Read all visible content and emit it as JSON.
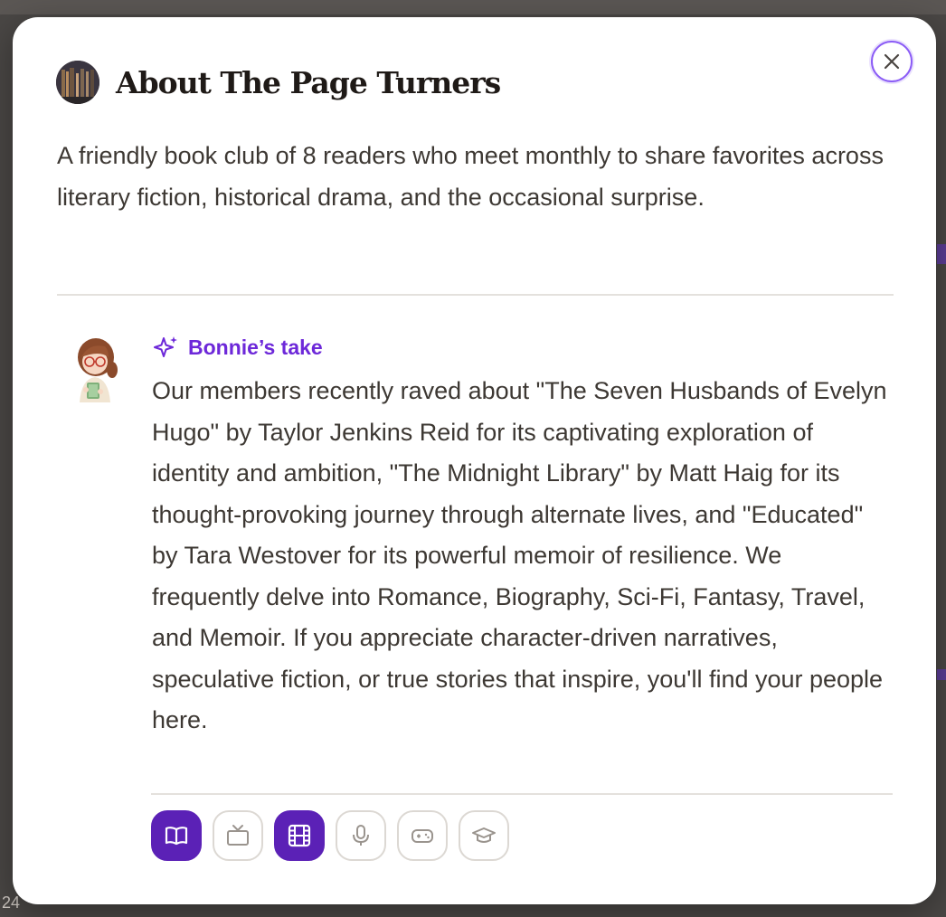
{
  "modal": {
    "title": "About The Page Turners",
    "description": "A friendly book club of 8 readers who meet monthly to share favorites across literary fiction, historical drama, and the occasional surprise.",
    "close_icon": "close-icon"
  },
  "take": {
    "label": "Bonnie’s take",
    "icon": "sparkle-icon",
    "body": "Our members recently raved about \"The Seven Husbands of Evelyn Hugo\" by Taylor Jenkins Reid for its captivating exploration of identity and ambition, \"The Midnight Library\" by Matt Haig for its thought-provoking journey through alternate lives, and \"Educated\" by Tara Westover for its powerful memoir of resilience. We frequently delve into Romance, Biography, Sci-Fi, Fantasy, Travel, and Memoir. If you appreciate character-driven narratives, speculative fiction, or true stories that inspire, you'll find your people here."
  },
  "media_filters": [
    {
      "icon": "book-icon",
      "active": true
    },
    {
      "icon": "tv-icon",
      "active": false
    },
    {
      "icon": "film-icon",
      "active": true
    },
    {
      "icon": "microphone-icon",
      "active": false
    },
    {
      "icon": "gamepad-icon",
      "active": false
    },
    {
      "icon": "graduation-cap-icon",
      "active": false
    }
  ],
  "background": {
    "peek_text_bottom_left": "24"
  },
  "colors": {
    "accent": "#6d28d9",
    "active_button": "#5b21b6",
    "focus_ring": "#8b5cf6",
    "text": "#3d3833",
    "title": "#1f1a17"
  }
}
